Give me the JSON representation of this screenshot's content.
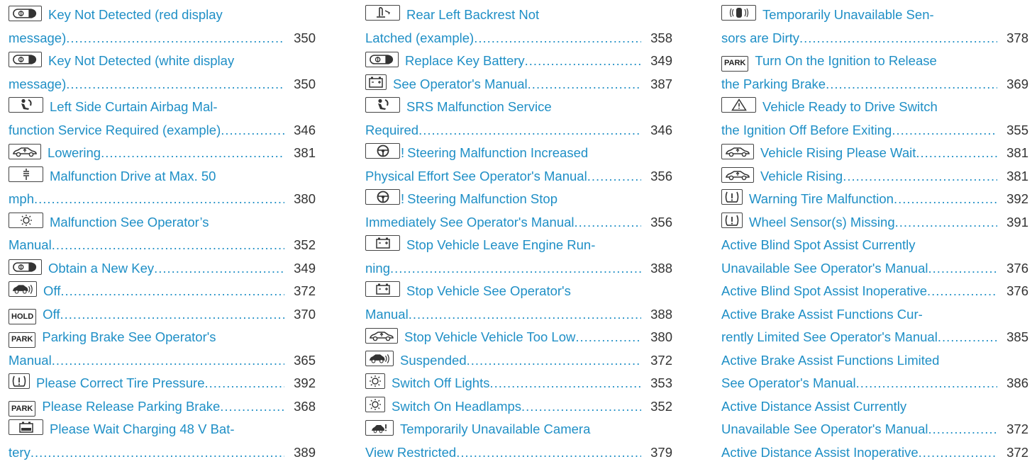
{
  "columns": [
    {
      "entries": [
        {
          "icon": "key-icon",
          "lines": [
            "Key Not Detected (red display",
            "message)"
          ],
          "page": "350"
        },
        {
          "icon": "key-icon",
          "lines": [
            "Key Not Detected (white display",
            "message)"
          ],
          "page": "350"
        },
        {
          "icon": "airbag-icon",
          "lines": [
            "Left Side Curtain Airbag Mal-",
            "function Service Required (example)"
          ],
          "page": "346"
        },
        {
          "icon": "vehicle-level-icon",
          "lines": [
            "Lowering"
          ],
          "page": "381"
        },
        {
          "icon": "suspension-icon",
          "lines": [
            "Malfunction Drive at Max. 50",
            "mph"
          ],
          "page": "380"
        },
        {
          "icon": "light-icon",
          "lines": [
            "Malfunction See Operator’s",
            "Manual"
          ],
          "page": "352"
        },
        {
          "icon": "key-icon",
          "lines": [
            "Obtain a New Key"
          ],
          "page": "349"
        },
        {
          "icon": "distance-assist-icon",
          "lines": [
            "Off"
          ],
          "page": "372"
        },
        {
          "icon": "hold-icon",
          "icon_text": "HOLD",
          "lines": [
            "Off"
          ],
          "page": "370"
        },
        {
          "icon": "park-icon",
          "icon_text": "PARK",
          "lines": [
            "Parking Brake See Operator's",
            "Manual"
          ],
          "page": "365"
        },
        {
          "icon": "tire-pressure-icon",
          "lines": [
            "Please Correct Tire Pressure"
          ],
          "page": "392"
        },
        {
          "icon": "park-icon",
          "icon_text": "PARK",
          "lines": [
            "Please Release Parking Brake"
          ],
          "page": "368"
        },
        {
          "icon": "battery-charging-icon",
          "lines": [
            "Please Wait Charging 48 V Bat-",
            "tery"
          ],
          "page": "389"
        }
      ]
    },
    {
      "entries": [
        {
          "icon": "backrest-icon",
          "lines": [
            "Rear Left Backrest Not",
            "Latched (example)"
          ],
          "page": "358"
        },
        {
          "icon": "key-icon",
          "lines": [
            "Replace Key Battery"
          ],
          "page": "349"
        },
        {
          "icon": "battery-icon",
          "lines": [
            "See Operator's Manual"
          ],
          "page": "387"
        },
        {
          "icon": "airbag-icon",
          "lines": [
            "SRS Malfunction Service",
            "Required"
          ],
          "page": "346"
        },
        {
          "icon": "steering-icon",
          "excl": "!",
          "lines": [
            "Steering Malfunction Increased",
            "Physical Effort See Operator's Manual"
          ],
          "page": "356"
        },
        {
          "icon": "steering-icon",
          "excl": "!",
          "lines": [
            "Steering Malfunction Stop",
            "Immediately See Operator's Manual"
          ],
          "page": "356"
        },
        {
          "icon": "battery-icon",
          "lines": [
            "Stop Vehicle Leave Engine Run-",
            "ning"
          ],
          "page": "388"
        },
        {
          "icon": "battery-icon",
          "lines": [
            "Stop Vehicle See Operator's",
            "Manual"
          ],
          "page": "388"
        },
        {
          "icon": "vehicle-level-icon",
          "lines": [
            "Stop Vehicle Vehicle Too Low"
          ],
          "page": "380"
        },
        {
          "icon": "distance-assist-icon",
          "lines": [
            "Suspended"
          ],
          "page": "372"
        },
        {
          "icon": "light-icon",
          "lines": [
            "Switch Off Lights"
          ],
          "page": "353"
        },
        {
          "icon": "light-icon",
          "lines": [
            "Switch On Headlamps"
          ],
          "page": "352"
        },
        {
          "icon": "camera-icon",
          "lines": [
            "Temporarily Unavailable Camera",
            "View Restricted"
          ],
          "page": "379"
        }
      ]
    },
    {
      "entries": [
        {
          "icon": "sensor-icon",
          "lines": [
            "Temporarily Unavailable Sen-",
            "sors are Dirty"
          ],
          "page": "378"
        },
        {
          "icon": "park-icon",
          "icon_text": "PARK",
          "lines": [
            "Turn On the Ignition to Release",
            "the Parking Brake"
          ],
          "page": "369"
        },
        {
          "icon": "warning-triangle-icon",
          "lines": [
            "Vehicle Ready to Drive Switch",
            "the Ignition Off Before Exiting"
          ],
          "page": "355"
        },
        {
          "icon": "vehicle-level-icon",
          "lines": [
            "Vehicle Rising Please Wait"
          ],
          "page": "381"
        },
        {
          "icon": "vehicle-level-icon",
          "lines": [
            "Vehicle Rising"
          ],
          "page": "381"
        },
        {
          "icon": "tire-pressure-icon",
          "lines": [
            "Warning Tire Malfunction"
          ],
          "page": "392"
        },
        {
          "icon": "tire-pressure-icon",
          "lines": [
            "Wheel Sensor(s) Missing"
          ],
          "page": "391"
        },
        {
          "lines": [
            "Active Blind Spot Assist Currently",
            "Unavailable See Operator's Manual"
          ],
          "page": "376"
        },
        {
          "lines": [
            "Active Blind Spot Assist Inoperative"
          ],
          "page": "376"
        },
        {
          "lines": [
            "Active Brake Assist Functions Cur-",
            "rently Limited See Operator's Manual"
          ],
          "page": "385"
        },
        {
          "lines": [
            "Active Brake Assist Functions Limited",
            "See Operator's Manual"
          ],
          "page": "386"
        },
        {
          "lines": [
            "Active Distance Assist Currently",
            "Unavailable See Operator's Manual"
          ],
          "page": "372"
        },
        {
          "lines": [
            "Active Distance Assist Inoperative"
          ],
          "page": "372"
        }
      ]
    }
  ]
}
